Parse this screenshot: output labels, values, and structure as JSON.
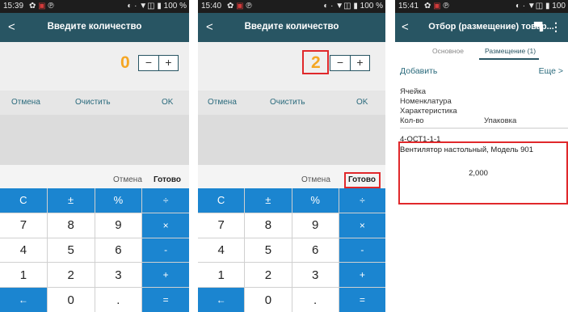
{
  "screens": [
    {
      "status": {
        "time": "15:39",
        "right": "◐ · ▼◫ ▮ 100 %"
      },
      "title": "Введите количество",
      "quantity": "0",
      "stepper": {
        "minus": "−",
        "plus": "+"
      },
      "actions": {
        "cancel": "Отмена",
        "clear": "Очистить",
        "ok": "OK"
      },
      "keyboard": {
        "cancel": "Отмена",
        "done": "Готово"
      }
    },
    {
      "status": {
        "time": "15:40",
        "right": "◐ · ▼◫ ▮ 100 %"
      },
      "title": "Введите количество",
      "quantity": "2",
      "stepper": {
        "minus": "−",
        "plus": "+"
      },
      "actions": {
        "cancel": "Отмена",
        "clear": "Очистить",
        "ok": "OK"
      },
      "keyboard": {
        "cancel": "Отмена",
        "done": "Готово"
      }
    },
    {
      "status": {
        "time": "15:41",
        "right": "◐ · ▼◫ ▮ 100"
      },
      "title": "Отбор (размещение) товар...",
      "tabs": [
        "Основное",
        "Размещение (1)"
      ],
      "add": "Добавить",
      "more": "Еще >",
      "fields": {
        "cell": "Ячейка",
        "nomenclature": "Номенклатура",
        "characteristic": "Характеристика",
        "qty": "Кол-во",
        "pack": "Упаковка"
      },
      "record": {
        "cell": "4-ОСТ1-1-1",
        "name": "Вентилятор настольный, Модель 901",
        "qty": "2,000"
      }
    }
  ],
  "keypad": [
    "C",
    "±",
    "%",
    "÷",
    "7",
    "8",
    "9",
    "×",
    "4",
    "5",
    "6",
    "-",
    "1",
    "2",
    "3",
    "+",
    "←",
    "0",
    ".",
    "="
  ],
  "accent_color": "#285563",
  "highlight_color": "#e0282b",
  "key_blue": "#1b85d0"
}
